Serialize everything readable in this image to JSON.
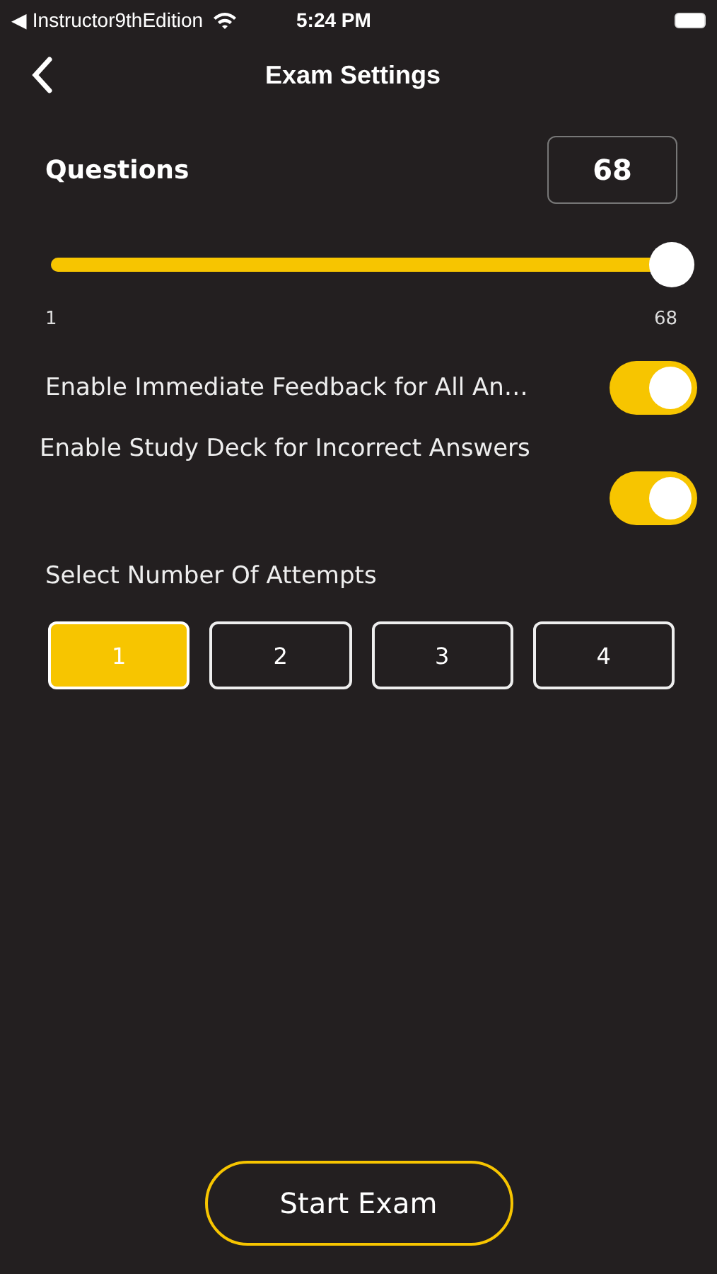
{
  "status_bar": {
    "back_app": "◀ Instructor9thEdition",
    "time": "5:24 PM"
  },
  "nav": {
    "title": "Exam Settings"
  },
  "questions": {
    "label": "Questions",
    "value": "68",
    "level": 1,
    "min_label": "1",
    "max_label": "68"
  },
  "toggles": [
    {
      "label": "Enable Immediate Feedback for All An…",
      "on": true,
      "stacked": false
    },
    {
      "label": "Enable Study Deck for Incorrect Answers",
      "on": true,
      "stacked": true
    }
  ],
  "attempts": {
    "label": "Select Number Of Attempts",
    "options": [
      {
        "label": "1",
        "selected": true
      },
      {
        "label": "2",
        "selected": false
      },
      {
        "label": "3",
        "selected": false
      },
      {
        "label": "4",
        "selected": false
      }
    ]
  },
  "start_button": "Start Exam"
}
